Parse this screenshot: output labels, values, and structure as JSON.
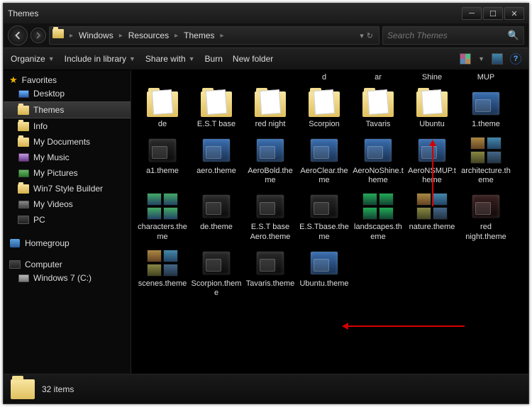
{
  "window": {
    "title": "Themes"
  },
  "breadcrumbs": [
    "Windows",
    "Resources",
    "Themes"
  ],
  "search": {
    "placeholder": "Search Themes"
  },
  "toolbar": {
    "organize": "Organize",
    "include": "Include in library",
    "share": "Share with",
    "burn": "Burn",
    "newfolder": "New folder"
  },
  "nav": {
    "favorites": "Favorites",
    "favitems": [
      "Desktop",
      "Themes",
      "Info",
      "My Documents",
      "My Music",
      "My Pictures",
      "Win7 Style Builder",
      "My Videos",
      "PC"
    ],
    "homegroup": "Homegroup",
    "computer": "Computer",
    "drives": [
      "Windows 7 (C:)"
    ]
  },
  "partial_row": [
    "d",
    "ar",
    "Shine",
    "MUP"
  ],
  "folders": [
    "de",
    "E.S.T base",
    "red night",
    "Scorpion",
    "Tavaris",
    "Ubuntu"
  ],
  "files_row1_last": "1.theme",
  "files_row2": [
    "a1.theme",
    "aero.theme",
    "AeroBold.theme",
    "AeroClear.theme",
    "AeroNoShine.theme",
    "AeroNSMUP.theme",
    "architecture.theme"
  ],
  "files_row3": [
    "characters.theme",
    "de.theme",
    "E.S.T base Aero.theme",
    "E.S.Tbase.theme",
    "landscapes.theme",
    "nature.theme",
    "red night.theme"
  ],
  "files_row4": [
    "scenes.theme",
    "Scorpion.theme",
    "Tavaris.theme",
    "Ubuntu.theme"
  ],
  "status": {
    "count": "32 items"
  }
}
